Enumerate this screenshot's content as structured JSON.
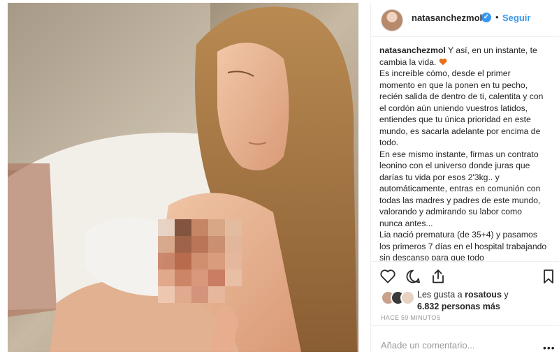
{
  "post": {
    "username": "natasanchezmol",
    "verified_icon": "verified-badge-icon",
    "follow_label": "Seguir",
    "separator": "•"
  },
  "caption": {
    "username": "natasanchezmol",
    "first_line": " Y así, en un instante, te cambia la vida.",
    "heart_color": "#e8701a",
    "paragraphs": [
      "Es increíble cómo, desde el primer momento en que la ponen en tu pecho, recién salida de dentro de ti, calentita y con el cordón aún uniendo vuestros latidos, entiendes que tu única prioridad en este mundo, es sacarla adelante por encima de todo.",
      "En ese mismo instante, firmas un contrato leonino con el universo donde juras que darías tu vida por esos 2'3kg.. y automáticamente, entras en comunión con todas las madres y padres de este mundo, valorando y admirando su labor como nunca antes...",
      "Lia nació prematura (de 35+4) y pasamos los primeros 7 días en el hospital trabajando sin descanso para que todo"
    ]
  },
  "actions": {
    "like_icon": "heart-outline-icon",
    "comment_icon": "comment-icon",
    "share_icon": "share-icon",
    "save_icon": "bookmark-icon"
  },
  "likes": {
    "prefix": "Les gusta a ",
    "user": "rosatous",
    "middle": " y",
    "count": "6.832 personas más"
  },
  "timestamp": "HACE 59 MINUTOS",
  "comment": {
    "placeholder": "Añade un comentario...",
    "more_label": "•••"
  },
  "colors": {
    "accent_blue": "#3897f0",
    "text": "#262626",
    "muted": "#999999",
    "divider": "#efefef"
  }
}
